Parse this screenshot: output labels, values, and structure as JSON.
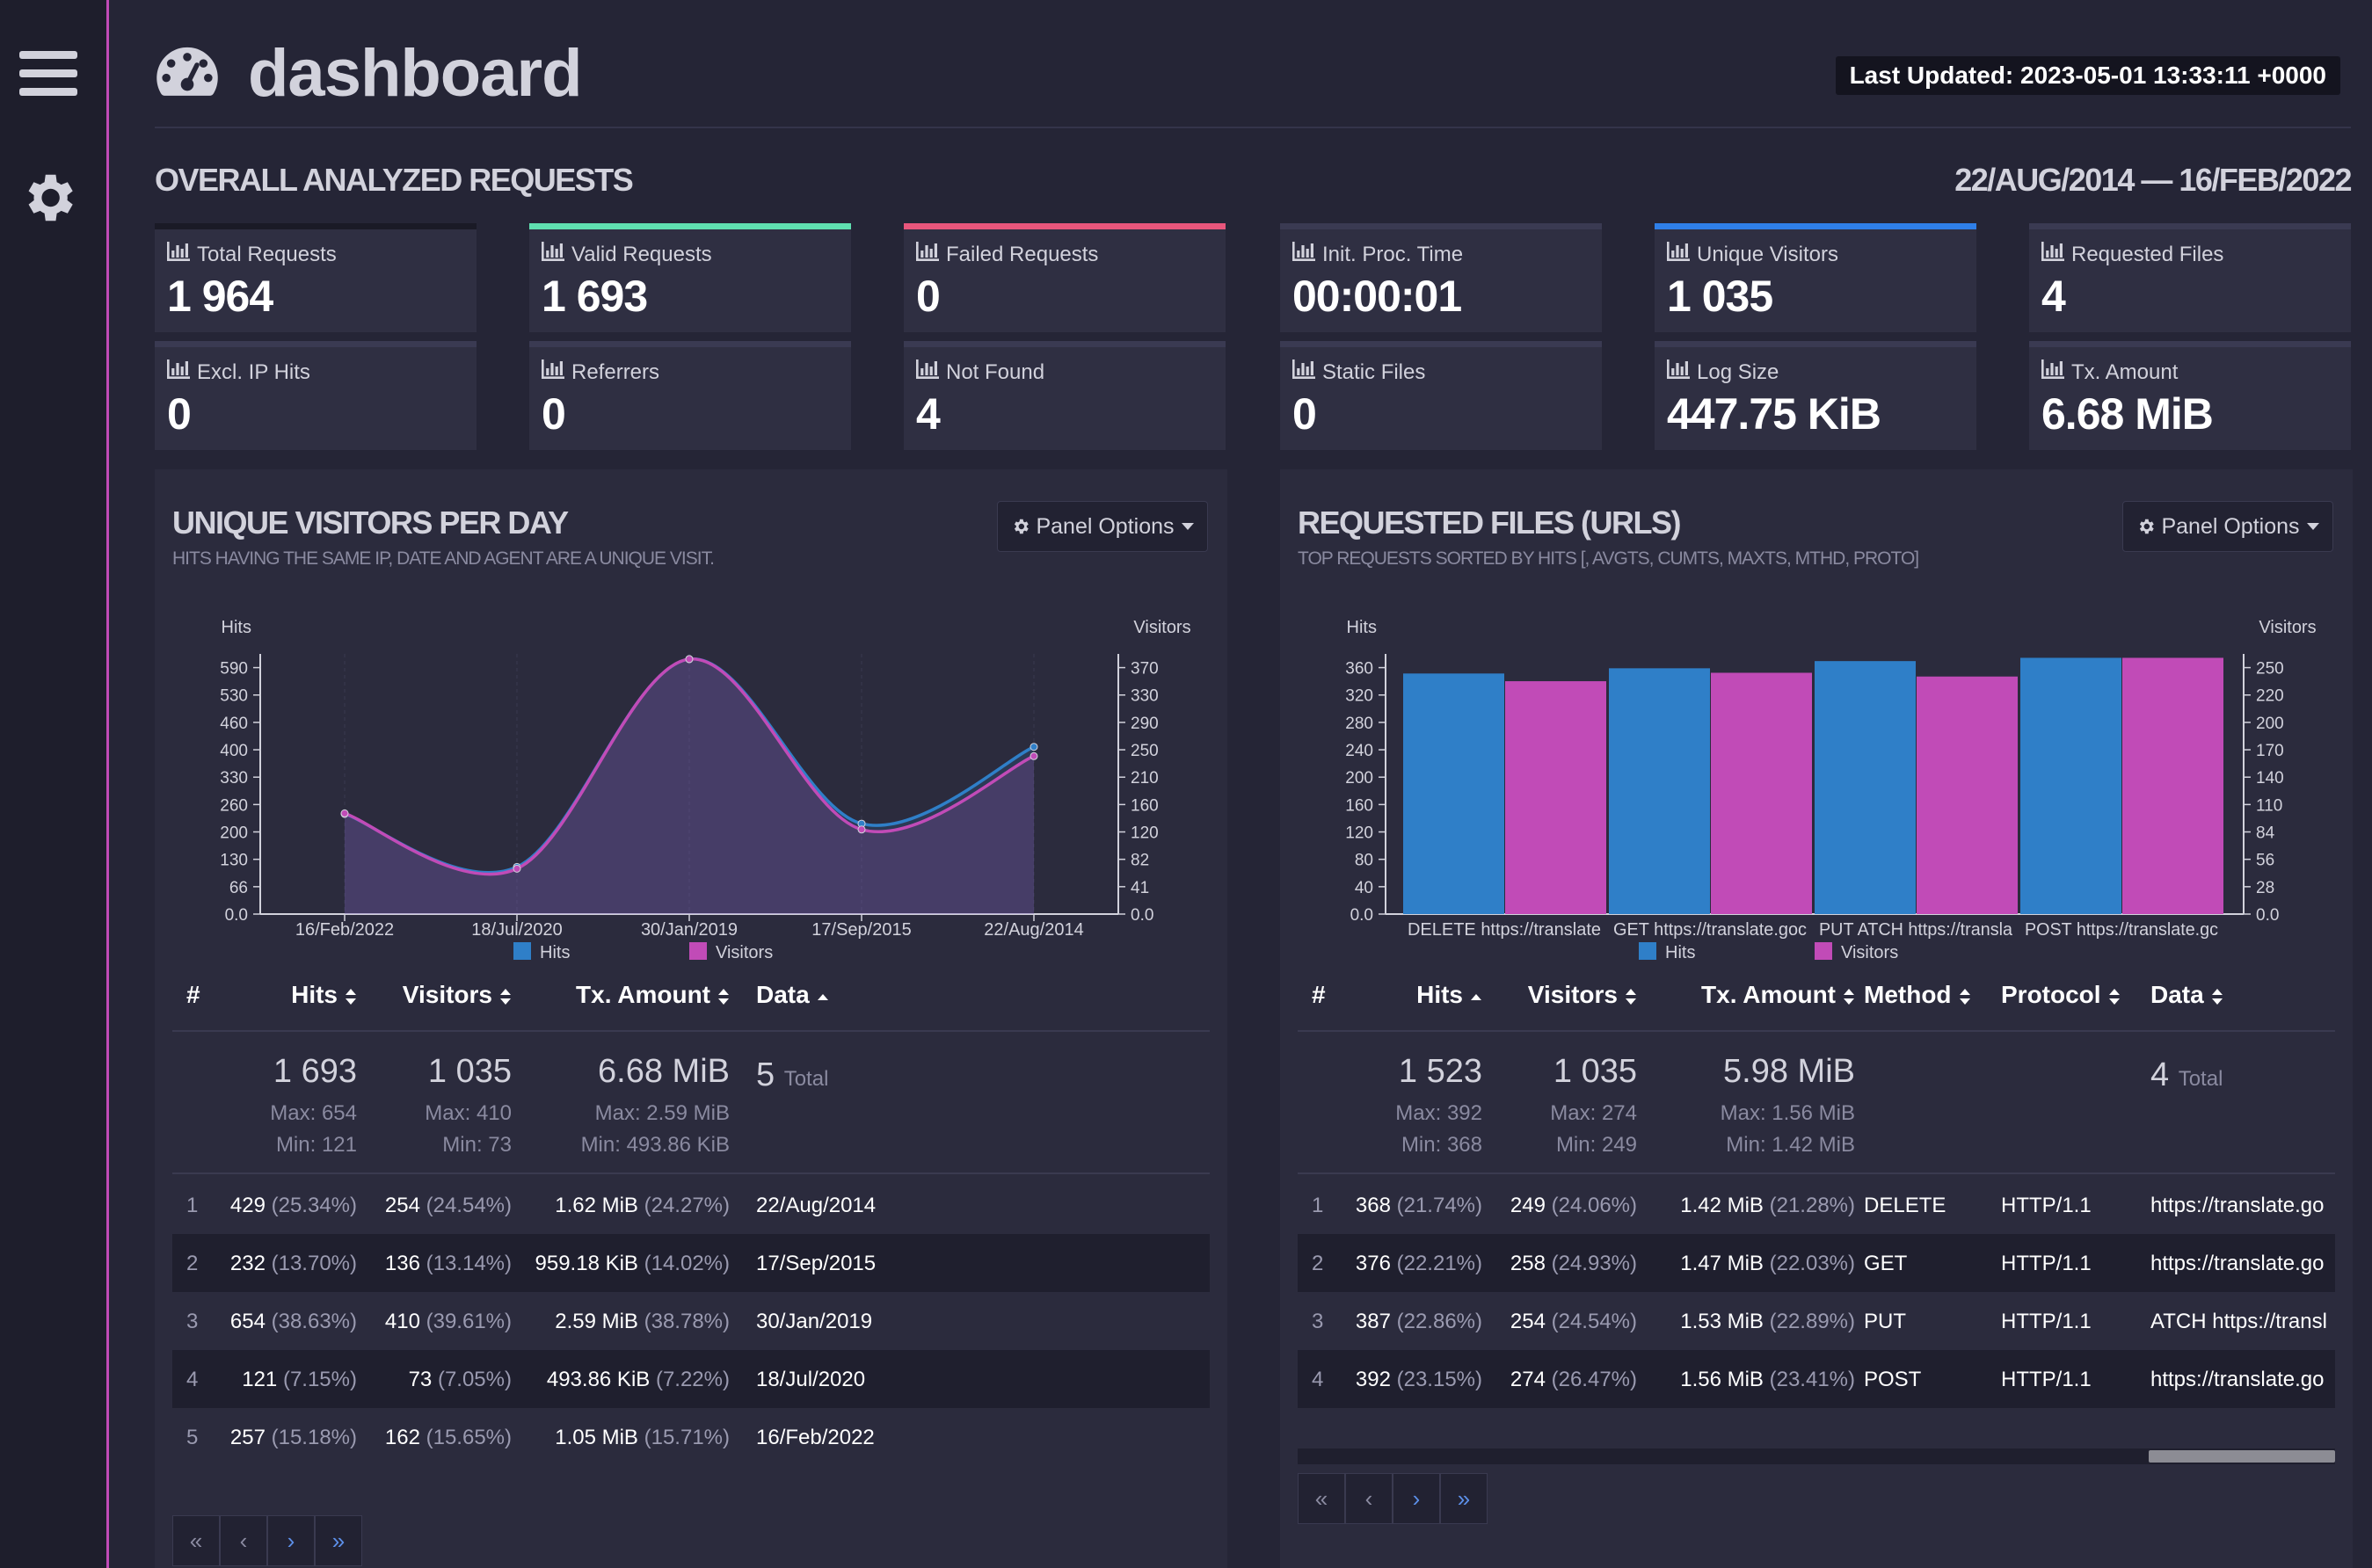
{
  "header": {
    "title": "dashboard",
    "last_updated": "Last Updated: 2023-05-01 13:33:11 +0000",
    "section_title": "OVERALL ANALYZED REQUESTS",
    "date_range": "22/AUG/2014 — 16/FEB/2022"
  },
  "cards": [
    {
      "label": "Total Requests",
      "value": "1 964",
      "accent": "#1a1a26"
    },
    {
      "label": "Valid Requests",
      "value": "1 693",
      "accent": "#5fe0b0"
    },
    {
      "label": "Failed Requests",
      "value": "0",
      "accent": "#e8567c"
    },
    {
      "label": "Init. Proc. Time",
      "value": "00:00:01",
      "accent": "#3a3a52"
    },
    {
      "label": "Unique Visitors",
      "value": "1 035",
      "accent": "#2f7fe8"
    },
    {
      "label": "Requested Files",
      "value": "4",
      "accent": "#3a3a52"
    },
    {
      "label": "Excl. IP Hits",
      "value": "0",
      "accent": "#3a3a52"
    },
    {
      "label": "Referrers",
      "value": "0",
      "accent": "#3a3a52"
    },
    {
      "label": "Not Found",
      "value": "4",
      "accent": "#3a3a52"
    },
    {
      "label": "Static Files",
      "value": "0",
      "accent": "#3a3a52"
    },
    {
      "label": "Log Size",
      "value": "447.75 KiB",
      "accent": "#3a3a52"
    },
    {
      "label": "Tx. Amount",
      "value": "6.68 MiB",
      "accent": "#3a3a52"
    }
  ],
  "visitors_panel": {
    "title": "UNIQUE VISITORS PER DAY",
    "subtitle": "HITS HAVING THE SAME IP, DATE AND AGENT ARE A UNIQUE VISIT.",
    "options_label": "Panel Options",
    "headers": [
      "#",
      "Hits",
      "Visitors",
      "Tx. Amount",
      "Data"
    ],
    "summary": {
      "hits": "1 693",
      "hits_max": "Max: 654",
      "hits_min": "Min: 121",
      "visitors": "1 035",
      "visitors_max": "Max: 410",
      "visitors_min": "Min: 73",
      "tx": "6.68 MiB",
      "tx_max": "Max: 2.59 MiB",
      "tx_min": "Min: 493.86 KiB",
      "total": "5",
      "total_label": "Total"
    },
    "rows": [
      {
        "n": "1",
        "hits": "429",
        "hits_pct": "(25.34%)",
        "visitors": "254",
        "visitors_pct": "(24.54%)",
        "tx": "1.62 MiB",
        "tx_pct": "(24.27%)",
        "data": "22/Aug/2014"
      },
      {
        "n": "2",
        "hits": "232",
        "hits_pct": "(13.70%)",
        "visitors": "136",
        "visitors_pct": "(13.14%)",
        "tx": "959.18 KiB",
        "tx_pct": "(14.02%)",
        "data": "17/Sep/2015"
      },
      {
        "n": "3",
        "hits": "654",
        "hits_pct": "(38.63%)",
        "visitors": "410",
        "visitors_pct": "(39.61%)",
        "tx": "2.59 MiB",
        "tx_pct": "(38.78%)",
        "data": "30/Jan/2019"
      },
      {
        "n": "4",
        "hits": "121",
        "hits_pct": "(7.15%)",
        "visitors": "73",
        "visitors_pct": "(7.05%)",
        "tx": "493.86 KiB",
        "tx_pct": "(7.22%)",
        "data": "18/Jul/2020"
      },
      {
        "n": "5",
        "hits": "257",
        "hits_pct": "(15.18%)",
        "visitors": "162",
        "visitors_pct": "(15.65%)",
        "tx": "1.05 MiB",
        "tx_pct": "(15.71%)",
        "data": "16/Feb/2022"
      }
    ],
    "pager": [
      "«",
      "‹",
      "›",
      "»"
    ]
  },
  "files_panel": {
    "title": "REQUESTED FILES (URLS)",
    "subtitle": "TOP REQUESTS SORTED BY HITS [, AVGTS, CUMTS, MAXTS, MTHD, PROTO]",
    "options_label": "Panel Options",
    "headers": [
      "#",
      "Hits",
      "Visitors",
      "Tx. Amount",
      "Method",
      "Protocol",
      "Data"
    ],
    "summary": {
      "hits": "1 523",
      "hits_max": "Max: 392",
      "hits_min": "Min: 368",
      "visitors": "1 035",
      "visitors_max": "Max: 274",
      "visitors_min": "Min: 249",
      "tx": "5.98 MiB",
      "tx_max": "Max: 1.56 MiB",
      "tx_min": "Min: 1.42 MiB",
      "total": "4",
      "total_label": "Total"
    },
    "rows": [
      {
        "n": "1",
        "hits": "368",
        "hits_pct": "(21.74%)",
        "visitors": "249",
        "visitors_pct": "(24.06%)",
        "tx": "1.42 MiB",
        "tx_pct": "(21.28%)",
        "method": "DELETE",
        "protocol": "HTTP/1.1",
        "data": "https://translate.go"
      },
      {
        "n": "2",
        "hits": "376",
        "hits_pct": "(22.21%)",
        "visitors": "258",
        "visitors_pct": "(24.93%)",
        "tx": "1.47 MiB",
        "tx_pct": "(22.03%)",
        "method": "GET",
        "protocol": "HTTP/1.1",
        "data": "https://translate.go"
      },
      {
        "n": "3",
        "hits": "387",
        "hits_pct": "(22.86%)",
        "visitors": "254",
        "visitors_pct": "(24.54%)",
        "tx": "1.53 MiB",
        "tx_pct": "(22.89%)",
        "method": "PUT",
        "protocol": "HTTP/1.1",
        "data": "ATCH https://transl"
      },
      {
        "n": "4",
        "hits": "392",
        "hits_pct": "(23.15%)",
        "visitors": "274",
        "visitors_pct": "(26.47%)",
        "tx": "1.56 MiB",
        "tx_pct": "(23.41%)",
        "method": "POST",
        "protocol": "HTTP/1.1",
        "data": "https://translate.go"
      }
    ],
    "pager": [
      "«",
      "‹",
      "›",
      "»"
    ]
  },
  "chart_data": [
    {
      "type": "area",
      "ylabel": "Hits",
      "y2label": "Visitors",
      "categories": [
        "16/Feb/2022",
        "18/Jul/2020",
        "30/Jan/2019",
        "17/Sep/2015",
        "22/Aug/2014"
      ],
      "series": [
        {
          "name": "Hits",
          "values": [
            257,
            121,
            654,
            232,
            429
          ],
          "color": "#2f7fc8"
        },
        {
          "name": "Visitors",
          "values": [
            162,
            73,
            410,
            136,
            254
          ],
          "color": "#c14bb7"
        }
      ],
      "ylim": [
        0,
        654
      ],
      "y2lim": [
        0,
        410
      ],
      "yticks": [
        "0.0",
        "66",
        "130",
        "200",
        "260",
        "330",
        "400",
        "460",
        "530",
        "590"
      ],
      "y2ticks": [
        "0.0",
        "41",
        "82",
        "120",
        "160",
        "210",
        "250",
        "290",
        "330",
        "370"
      ],
      "legend": "bottom"
    },
    {
      "type": "bar",
      "ylabel": "Hits",
      "y2label": "Visitors",
      "categories": [
        "DELETE https://translate",
        "GET https://translate.goc",
        "PUT ATCH https://transla",
        "POST https://translate.gc"
      ],
      "series": [
        {
          "name": "Hits",
          "values": [
            368,
            376,
            387,
            392
          ],
          "color": "#2f7fc8"
        },
        {
          "name": "Visitors",
          "values": [
            249,
            258,
            254,
            274
          ],
          "color": "#c14bb7"
        }
      ],
      "ylim": [
        0,
        392
      ],
      "y2lim": [
        0,
        274
      ],
      "yticks": [
        "0.0",
        "40",
        "80",
        "120",
        "160",
        "200",
        "240",
        "280",
        "320",
        "360"
      ],
      "y2ticks": [
        "0.0",
        "28",
        "56",
        "84",
        "110",
        "140",
        "170",
        "200",
        "220",
        "250"
      ],
      "legend": "bottom"
    }
  ]
}
